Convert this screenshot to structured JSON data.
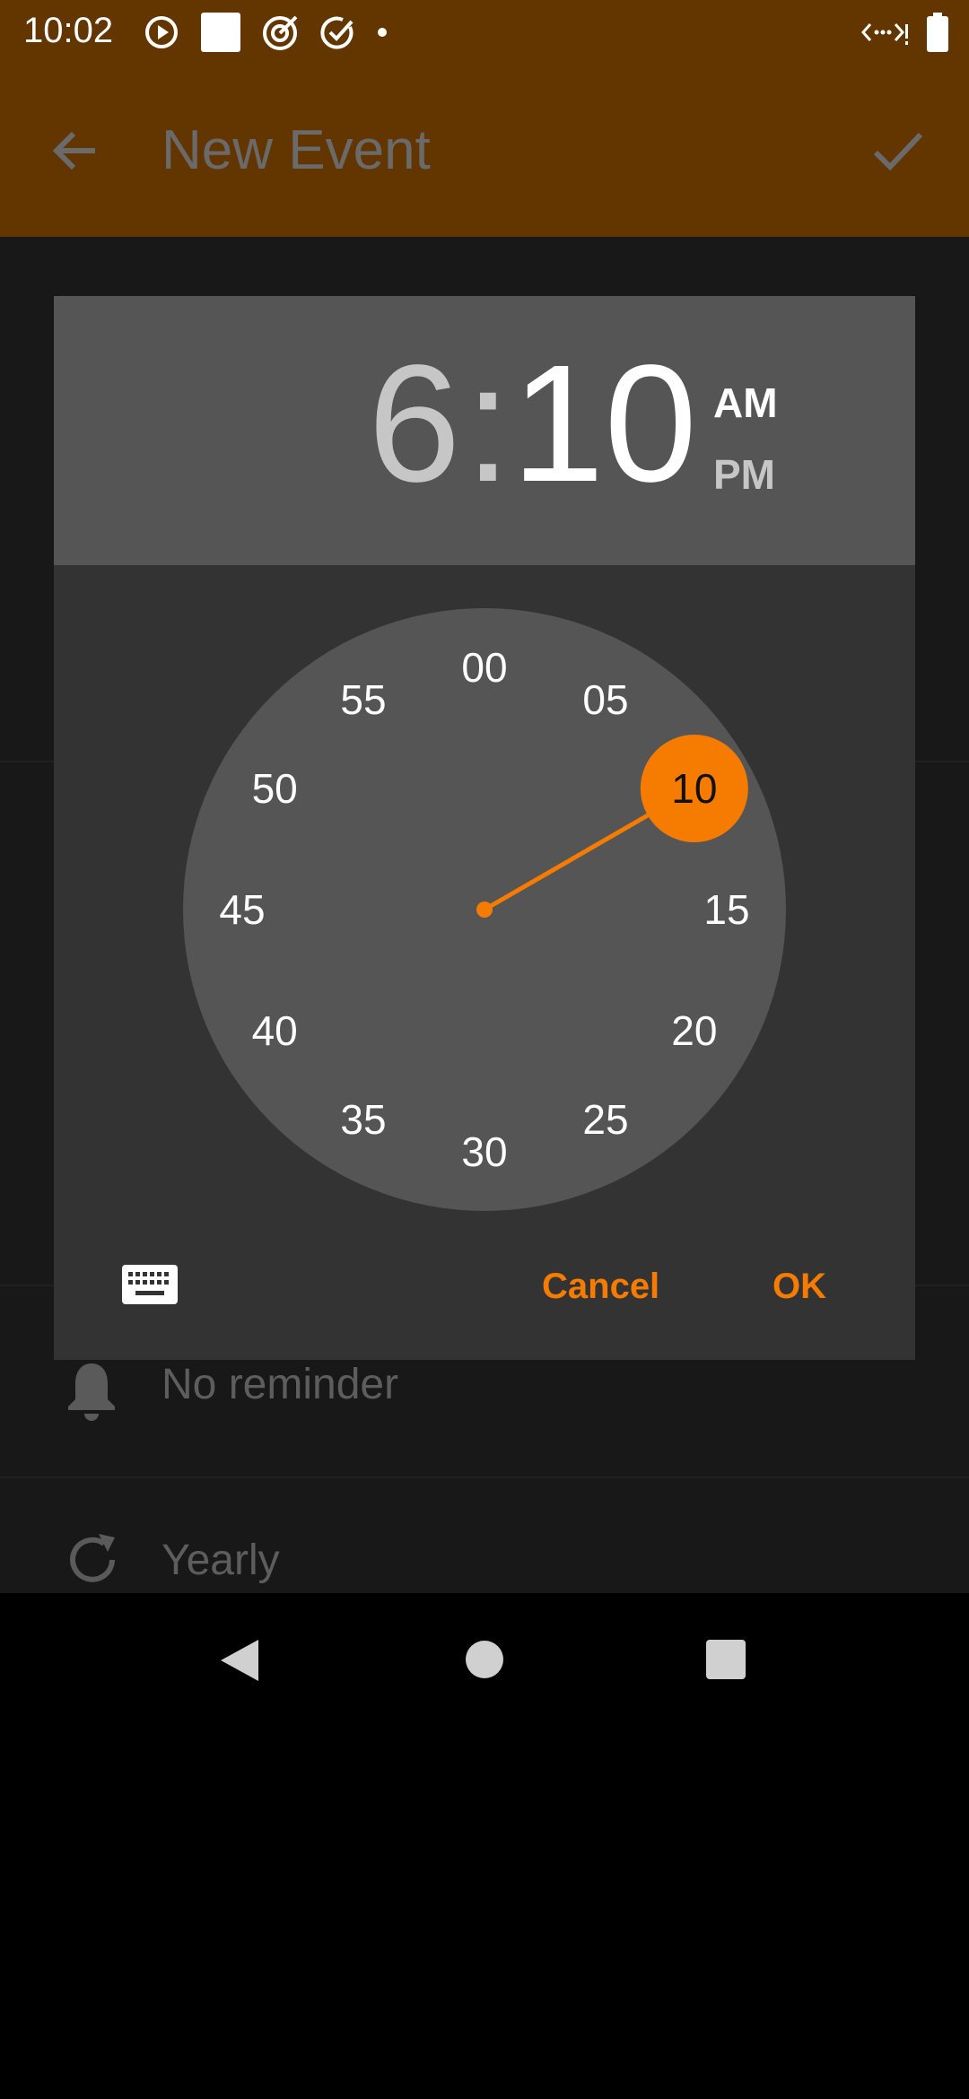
{
  "status_bar": {
    "time": "10:02",
    "icons": [
      "play-circle-icon",
      "square-app-icon",
      "target-icon",
      "check-circle-icon",
      "dot-icon"
    ],
    "right_icons": [
      "data-saver-icon",
      "battery-icon"
    ]
  },
  "app_bar": {
    "title": "New Event",
    "back_icon": "arrow-back-icon",
    "save_icon": "check-icon",
    "color": "#633600"
  },
  "background_rows": {
    "reminder": "No reminder",
    "repeat": "Yearly"
  },
  "time_picker": {
    "hour": "6",
    "separator": ":",
    "minute": "10",
    "am_label": "AM",
    "pm_label": "PM",
    "selected_period": "AM",
    "dial_labels": [
      "00",
      "05",
      "10",
      "15",
      "20",
      "25",
      "30",
      "35",
      "40",
      "45",
      "50",
      "55"
    ],
    "selected_minute": "10",
    "accent": "#f57c00",
    "cancel_label": "Cancel",
    "ok_label": "OK",
    "keyboard_icon": "keyboard-icon"
  },
  "nav_bar": {
    "icons": [
      "back-triangle-icon",
      "home-circle-icon",
      "recents-square-icon"
    ]
  }
}
